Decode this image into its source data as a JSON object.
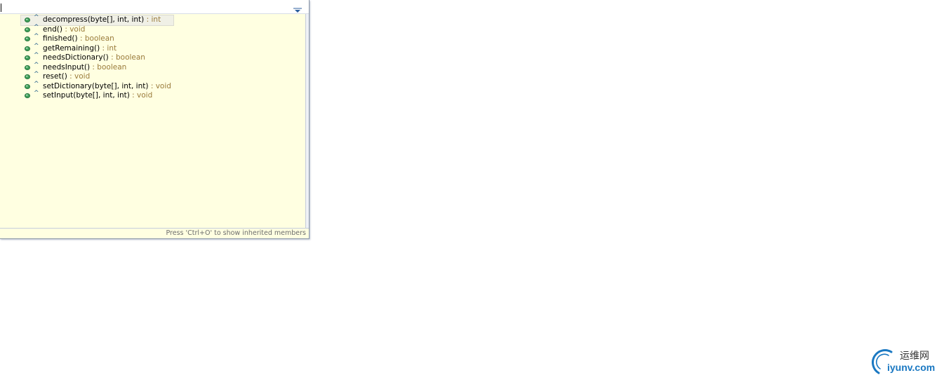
{
  "filter": {
    "value": "",
    "menu_icon": "chevron-down-icon"
  },
  "members": [
    {
      "signature": "decompress(byte[], int, int)",
      "return_type": " : int",
      "icon": "public-method-icon",
      "modifier": "^",
      "selected": true
    },
    {
      "signature": "end()",
      "return_type": " : void",
      "icon": "public-method-icon",
      "modifier": "^",
      "selected": false
    },
    {
      "signature": "finished()",
      "return_type": " : boolean",
      "icon": "public-method-icon",
      "modifier": "^",
      "selected": false
    },
    {
      "signature": "getRemaining()",
      "return_type": " : int",
      "icon": "public-method-icon",
      "modifier": "^",
      "selected": false
    },
    {
      "signature": "needsDictionary()",
      "return_type": " : boolean",
      "icon": "public-method-icon",
      "modifier": "^",
      "selected": false
    },
    {
      "signature": "needsInput()",
      "return_type": " : boolean",
      "icon": "public-method-icon",
      "modifier": "^",
      "selected": false
    },
    {
      "signature": "reset()",
      "return_type": " : void",
      "icon": "public-method-icon",
      "modifier": "^",
      "selected": false
    },
    {
      "signature": "setDictionary(byte[], int, int)",
      "return_type": " : void",
      "icon": "public-method-icon",
      "modifier": "^",
      "selected": false
    },
    {
      "signature": "setInput(byte[], int, int)",
      "return_type": " : void",
      "icon": "public-method-icon",
      "modifier": "^",
      "selected": false
    }
  ],
  "status": {
    "hint": "Press 'Ctrl+O' to show inherited members"
  },
  "watermark": {
    "chinese": "运维网",
    "domain": "iyunv.com"
  },
  "colors": {
    "popup_background": "#ffffe1",
    "method_icon_fill": "#3f9e5a",
    "return_type": "#9a7b3a",
    "watermark_blue": "#1a78c2"
  }
}
